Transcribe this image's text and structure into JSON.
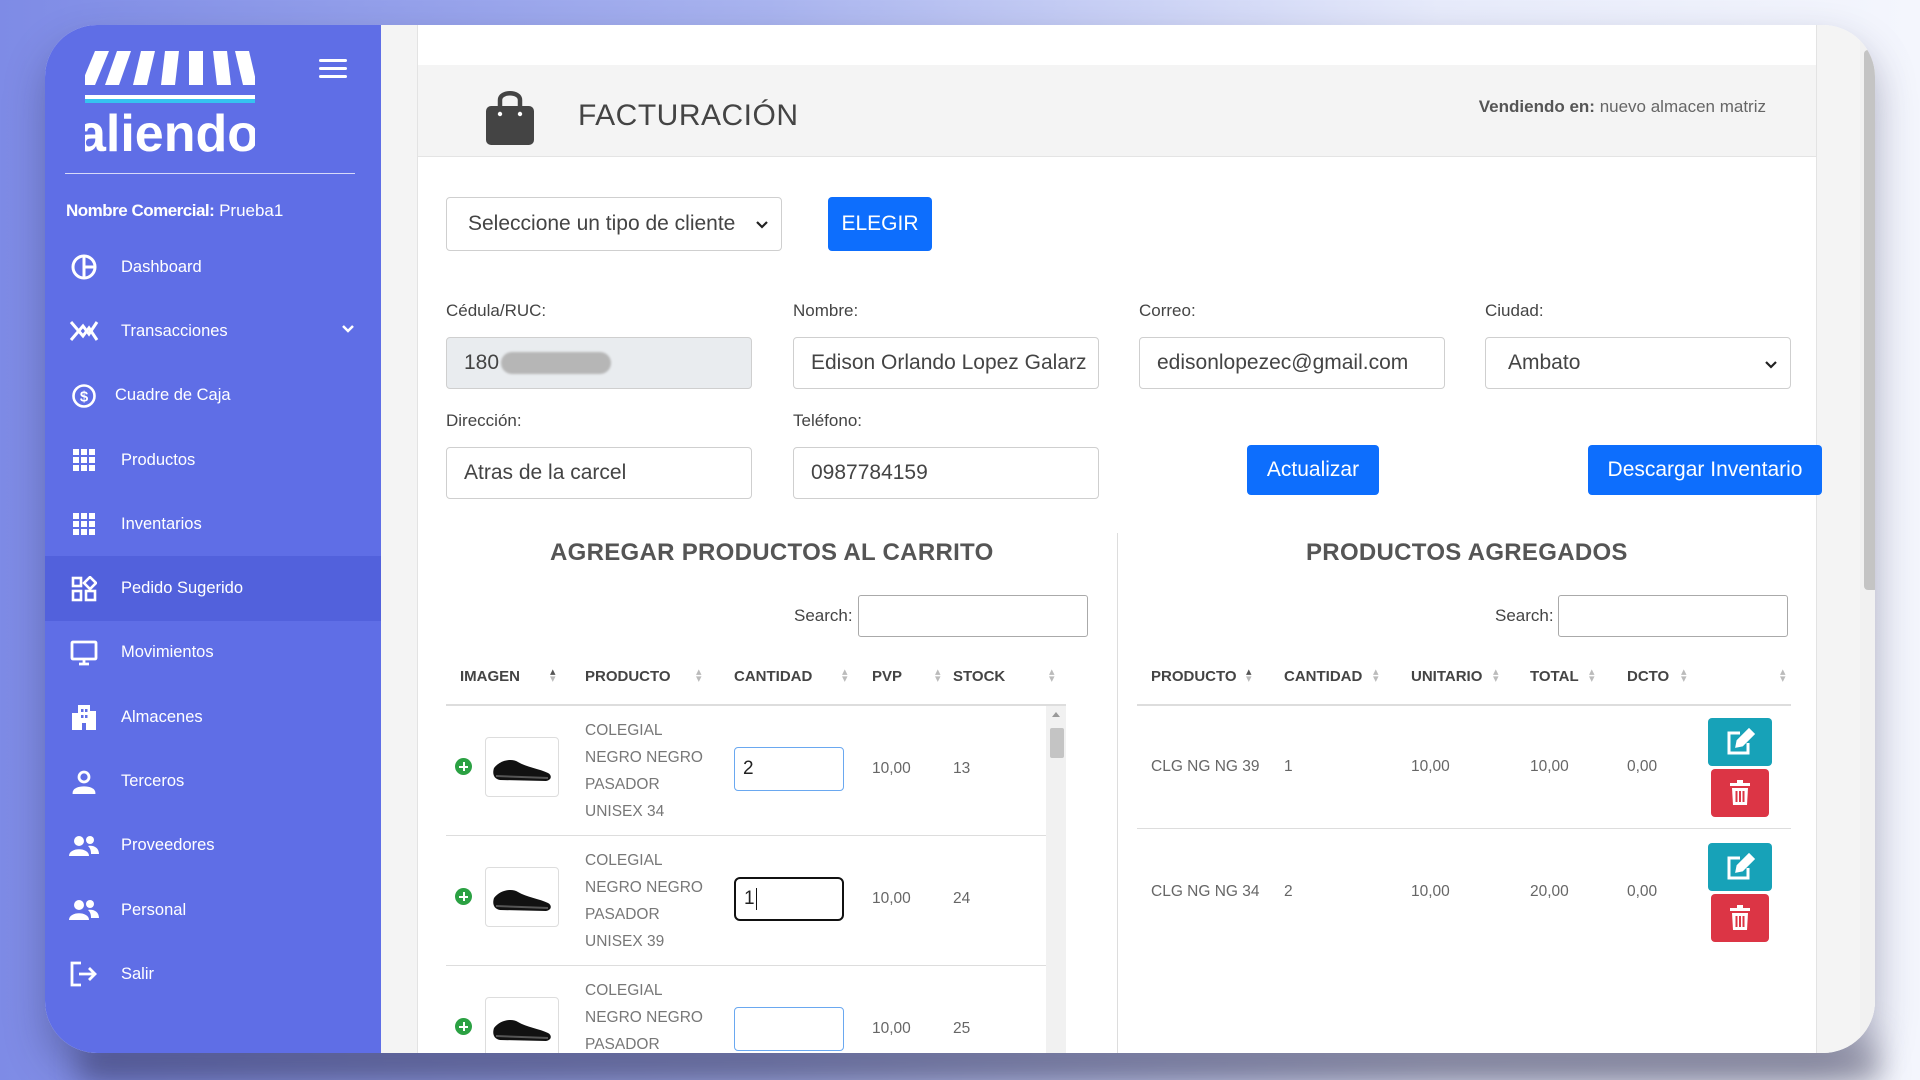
{
  "sidebar": {
    "brand": "aliendo",
    "business_label": "Nombre Comercial:",
    "business_name": "Prueba1",
    "items": [
      {
        "label": "Dashboard",
        "icon": "dashboard-icon"
      },
      {
        "label": "Transacciones",
        "icon": "transactions-icon"
      },
      {
        "label": "Cuadre de Caja",
        "icon": "dollar-circle-icon"
      },
      {
        "label": "Productos",
        "icon": "grid-icon"
      },
      {
        "label": "Inventarios",
        "icon": "grid-icon"
      },
      {
        "label": "Pedido Sugerido",
        "icon": "apps-icon"
      },
      {
        "label": "Movimientos",
        "icon": "monitor-icon"
      },
      {
        "label": "Almacenes",
        "icon": "building-icon"
      },
      {
        "label": "Terceros",
        "icon": "user-icon"
      },
      {
        "label": "Proveedores",
        "icon": "users-icon"
      },
      {
        "label": "Personal",
        "icon": "users-icon"
      },
      {
        "label": "Salir",
        "icon": "logout-icon"
      }
    ],
    "active_item": "Pedido Sugerido"
  },
  "header": {
    "title": "FACTURACIÓN",
    "selling_label": "Vendiendo en:",
    "selling_value": "nuevo almacen matriz"
  },
  "client_type": {
    "placeholder": "Seleccione un tipo de cliente",
    "button": "ELEGIR"
  },
  "form": {
    "cedula_label": "Cédula/RUC:",
    "cedula_value": "180",
    "nombre_label": "Nombre:",
    "nombre_value": "Edison Orlando Lopez Galarz",
    "correo_label": "Correo:",
    "correo_value": "edisonlopezec@gmail.com",
    "ciudad_label": "Ciudad:",
    "ciudad_value": "Ambato",
    "direccion_label": "Dirección:",
    "direccion_value": "Atras de la carcel",
    "telefono_label": "Teléfono:",
    "telefono_value": "0987784159",
    "update_button": "Actualizar",
    "download_button": "Descargar Inventario"
  },
  "cart": {
    "title": "AGREGAR PRODUCTOS AL CARRITO",
    "search_label": "Search:",
    "columns": [
      "IMAGEN",
      "PRODUCTO",
      "CANTIDAD",
      "PVP",
      "STOCK"
    ],
    "rows": [
      {
        "product_lines": [
          "COLEGIAL",
          "NEGRO NEGRO",
          "PASADOR",
          "UNISEX 34"
        ],
        "qty": "2",
        "pvp": "10,00",
        "stock": "13"
      },
      {
        "product_lines": [
          "COLEGIAL",
          "NEGRO NEGRO",
          "PASADOR",
          "UNISEX 39"
        ],
        "qty": "1",
        "pvp": "10,00",
        "stock": "24"
      },
      {
        "product_lines": [
          "COLEGIAL",
          "NEGRO NEGRO",
          "PASADOR",
          ""
        ],
        "qty": "",
        "pvp": "10,00",
        "stock": "25"
      }
    ]
  },
  "added": {
    "title": "PRODUCTOS AGREGADOS",
    "search_label": "Search:",
    "columns": [
      "PRODUCTO",
      "CANTIDAD",
      "UNITARIO",
      "TOTAL",
      "DCTO"
    ],
    "rows": [
      {
        "producto": "CLG NG NG 39",
        "cantidad": "1",
        "unitario": "10,00",
        "total": "10,00",
        "dcto": "0,00"
      },
      {
        "producto": "CLG NG NG 34",
        "cantidad": "2",
        "unitario": "10,00",
        "total": "20,00",
        "dcto": "0,00"
      }
    ]
  },
  "colors": {
    "sidebar": "#5f6ee6",
    "sidebar_active": "#5261dc",
    "primary": "#0d6efd",
    "edit": "#17a2b8",
    "delete": "#dc3545",
    "add": "#2ba143"
  }
}
